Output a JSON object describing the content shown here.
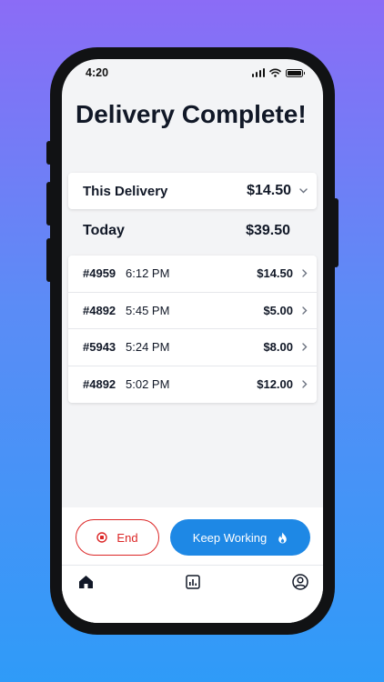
{
  "status_bar": {
    "time": "4:20"
  },
  "title": "Delivery Complete!",
  "this_delivery": {
    "label": "This Delivery",
    "amount": "$14.50"
  },
  "today": {
    "label": "Today",
    "amount": "$39.50"
  },
  "orders": [
    {
      "id": "#4959",
      "time": "6:12 PM",
      "amount": "$14.50"
    },
    {
      "id": "#4892",
      "time": "5:45 PM",
      "amount": "$5.00"
    },
    {
      "id": "#5943",
      "time": "5:24 PM",
      "amount": "$8.00"
    },
    {
      "id": "#4892",
      "time": "5:02 PM",
      "amount": "$12.00"
    }
  ],
  "actions": {
    "end_label": "End",
    "keep_working_label": "Keep Working"
  },
  "nav": {
    "items": [
      "home-icon",
      "stats-icon",
      "profile-icon"
    ]
  },
  "colors": {
    "accent": "#1e88e5",
    "danger": "#dc2626",
    "text": "#111827"
  }
}
